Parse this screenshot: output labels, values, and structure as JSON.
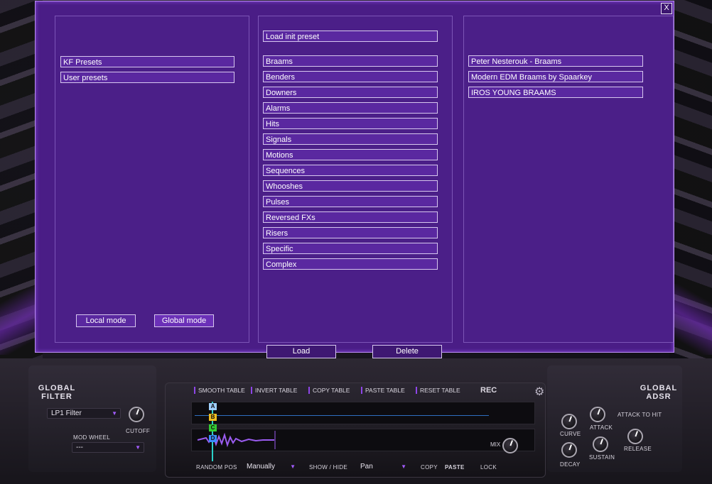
{
  "dialog": {
    "close_label": "X",
    "categories": [
      "KF Presets",
      "User presets"
    ],
    "modes": {
      "local": "Local mode",
      "global": "Global mode"
    },
    "init_preset": "Load init preset",
    "folders": [
      "Braams",
      "Benders",
      "Downers",
      "Alarms",
      "Hits",
      "Signals",
      "Motions",
      "Sequences",
      "Whooshes",
      "Pulses",
      "Reversed FXs",
      "Risers",
      "Specific",
      "Complex"
    ],
    "presets": [
      "Peter Nesterouk - Braams",
      "Modern EDM Braams by Spaarkey",
      "IROS YOUNG BRAAMS"
    ],
    "load_label": "Load",
    "delete_label": "Delete"
  },
  "global_filter": {
    "title_line1": "GLOBAL",
    "title_line2": "FILTER",
    "filter_type": "LP1 Filter",
    "cutoff_label": "CUTOFF",
    "mod_label": "MOD WHEEL",
    "mod_value": "---"
  },
  "table_toolbar": {
    "smooth": "SMOOTH TABLE",
    "invert": "INVERT TABLE",
    "copy": "COPY TABLE",
    "paste": "PASTE TABLE",
    "reset": "RESET TABLE",
    "rec": "REC"
  },
  "layers": [
    {
      "label": "A",
      "color": "#9fd0ff"
    },
    {
      "label": "B",
      "color": "#f0c020"
    },
    {
      "label": "C",
      "color": "#33cc33"
    },
    {
      "label": "D",
      "color": "#3a8cff"
    }
  ],
  "mix_label": "MIX",
  "bottom_bar": {
    "random_pos": "RANDOM POS",
    "manually": "Manually",
    "show_hide": "SHOW / HIDE",
    "pan": "Pan",
    "copy": "COPY",
    "paste": "PASTE",
    "lock": "LOCK"
  },
  "global_adsr": {
    "title_line1": "GLOBAL",
    "title_line2": "ADSR",
    "curve": "CURVE",
    "attack": "ATTACK",
    "attack_to_hit": "ATTACK TO HIT",
    "decay": "DECAY",
    "sustain": "SUSTAIN",
    "release": "RELEASE"
  },
  "colors": {
    "dialog_bg": "#4a1d86",
    "accent": "#8e46e8"
  }
}
